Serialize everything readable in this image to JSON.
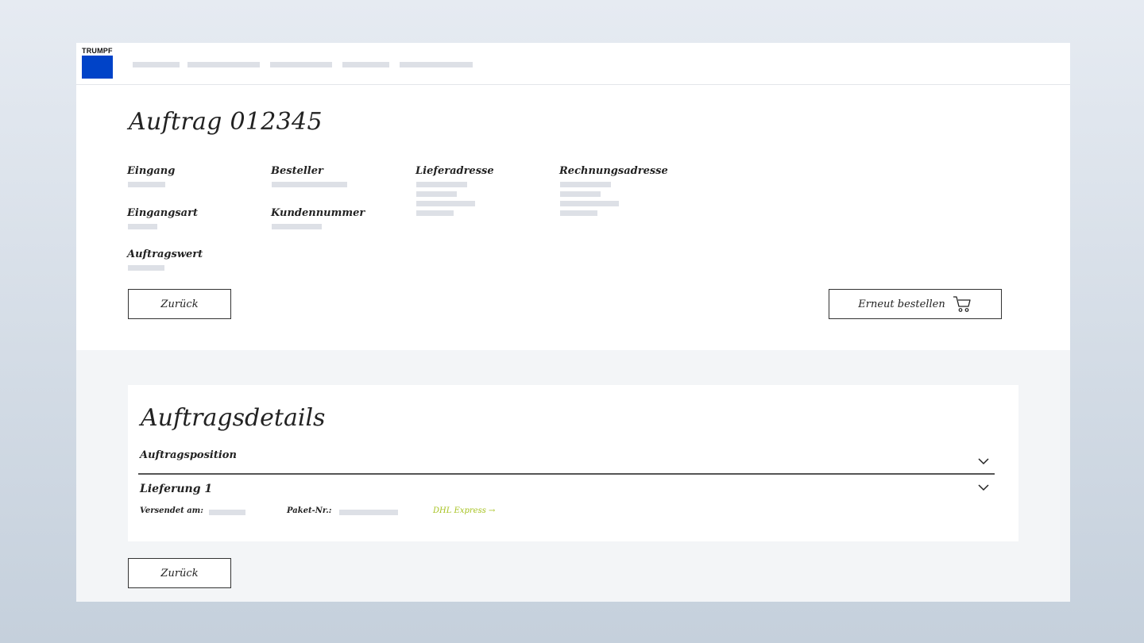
{
  "header": {
    "logo_text": "TRUMPF",
    "brand_color": "#0043c8",
    "nav_items": [
      "",
      "",
      "",
      "",
      ""
    ]
  },
  "order": {
    "title": "Auftrag 012345",
    "fields": {
      "eingang": "Eingang",
      "besteller": "Besteller",
      "lieferadresse": "Lieferadresse",
      "rechnungsadresse": "Rechnungsadresse",
      "eingangsart": "Eingangsart",
      "kundennummer": "Kundennummer",
      "auftragswert": "Auftragswert"
    },
    "back_label": "Zurück",
    "reorder_label": "Erneut bestellen"
  },
  "details": {
    "title": "Auftragsdetails",
    "position_label": "Auftragsposition",
    "delivery_label": "Lieferung 1",
    "shipped_label": "Versendet am:",
    "package_label": "Paket-Nr.:",
    "carrier_link": "DHL Express →",
    "carrier_color": "#a6c21f"
  },
  "footer": {
    "back_label": "Zurück"
  }
}
